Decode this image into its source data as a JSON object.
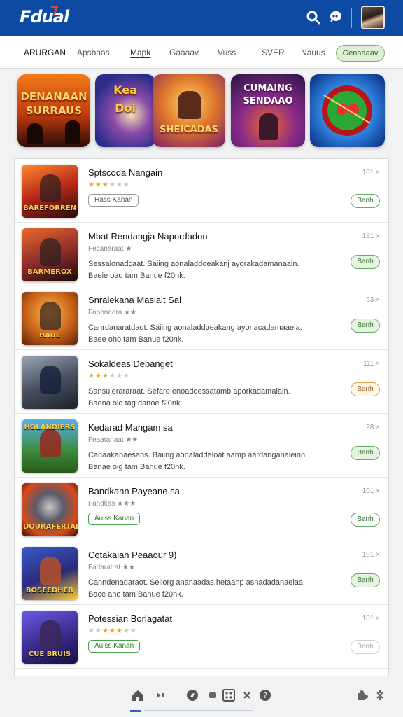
{
  "app": {
    "logo_text": "Fdual",
    "brand_color": "#0d4aa3"
  },
  "topbar": {
    "icons": [
      "search-icon",
      "chat-icon",
      "avatar"
    ]
  },
  "tabs": {
    "items": [
      {
        "label": "ARURGAN"
      },
      {
        "label": "Apsbaas"
      },
      {
        "label": "Mapk"
      },
      {
        "label": "Gaaaav"
      },
      {
        "label": "Vuss"
      },
      {
        "label": "SVER"
      },
      {
        "label": "Nauus"
      }
    ],
    "active_index": 2,
    "pill_label": "Genaaaav"
  },
  "banners": [
    {
      "title": "DENANAAN\nSURRAUS"
    },
    {
      "title": "Kea\nDoi"
    },
    {
      "title": "SHEICADAS"
    },
    {
      "title": "CUMAING\nSENDAAO"
    },
    {
      "title": ""
    }
  ],
  "apps": [
    {
      "title": "Sptscoda Nangain",
      "rating": 3,
      "tag": "Hass Kanan",
      "tag_style": "plain",
      "count": "101",
      "button": "Banh",
      "button_style": "plain",
      "thumb_label": "BAREFORREN"
    },
    {
      "title": "Mbat Rendangja Napordadon",
      "subtitle": "Fecanaraat ★",
      "desc": [
        "Sessalonadcaat. Saiing aonaladdoeakanj ayorakadamanaain.",
        "Baeie oao tam Banue f20nk."
      ],
      "count": "181",
      "button": "Banh",
      "button_style": "filled",
      "thumb_label": "BARMEROX"
    },
    {
      "title": "Snralekana Masiait Sal",
      "subtitle": "Faponeera ★★",
      "desc": [
        "Canrdanaratdaot. Saiing aonaladdoeakang ayorlacadamaaeia.",
        "Baee oho tam Banue f20nk."
      ],
      "count": "93",
      "button": "Banh",
      "button_style": "filled",
      "thumb_label": "HAUL"
    },
    {
      "title": "Sokaldeas Depanget",
      "rating": 3,
      "desc": [
        "Sansulerararaat. Sefaro enoadoessatamb aporkadamaiain.",
        "Baena oio tag danoe f20nk."
      ],
      "count": "111",
      "button": "Banh",
      "button_style": "orange",
      "thumb_label": ""
    },
    {
      "title": "Kedarad Mangam sa",
      "subtitle": "Feaatanaat ★★",
      "desc": [
        "Canaakanaesans. Baiing aonaladdeloat aamp aardanganaleinn.",
        "Banae oig tam Banue f20nk."
      ],
      "count": "28",
      "button": "Banh",
      "button_style": "filled",
      "thumb_label": "HOLANDIERS"
    },
    {
      "title": "Bandkann Payeane sa",
      "subtitle": "Fandkas ★★★",
      "tag": "Auiss Kanan",
      "tag_style": "green",
      "count": "101",
      "button": "Banh",
      "button_style": "plain",
      "thumb_label": "DOURAFERTAR"
    },
    {
      "title": "Cotakaian Peaaour 9)",
      "subtitle": "Farlaratrat ★★",
      "desc": [
        "Canndenadaraot. Seilorg ananaadas.hetaanp asnadadanaeiaa.",
        "Bace aho tam Banue f20nk."
      ],
      "count": "101",
      "button": "Banh",
      "button_style": "filled",
      "thumb_label": "BOSEEDHER"
    },
    {
      "title": "Potessian Borlagatat",
      "rating": 3,
      "tag": "Auiss Kanan",
      "tag_style": "green",
      "count": "101",
      "button": "Banh",
      "button_style": "faded",
      "thumb_label": "CUE BRUIS"
    }
  ],
  "bottom_nav": {
    "icons": [
      "home-icon",
      "play-icon",
      "compass-icon",
      "dice-icon",
      "cross-icon",
      "help-icon",
      "grid-icon",
      "settings-icon"
    ]
  }
}
